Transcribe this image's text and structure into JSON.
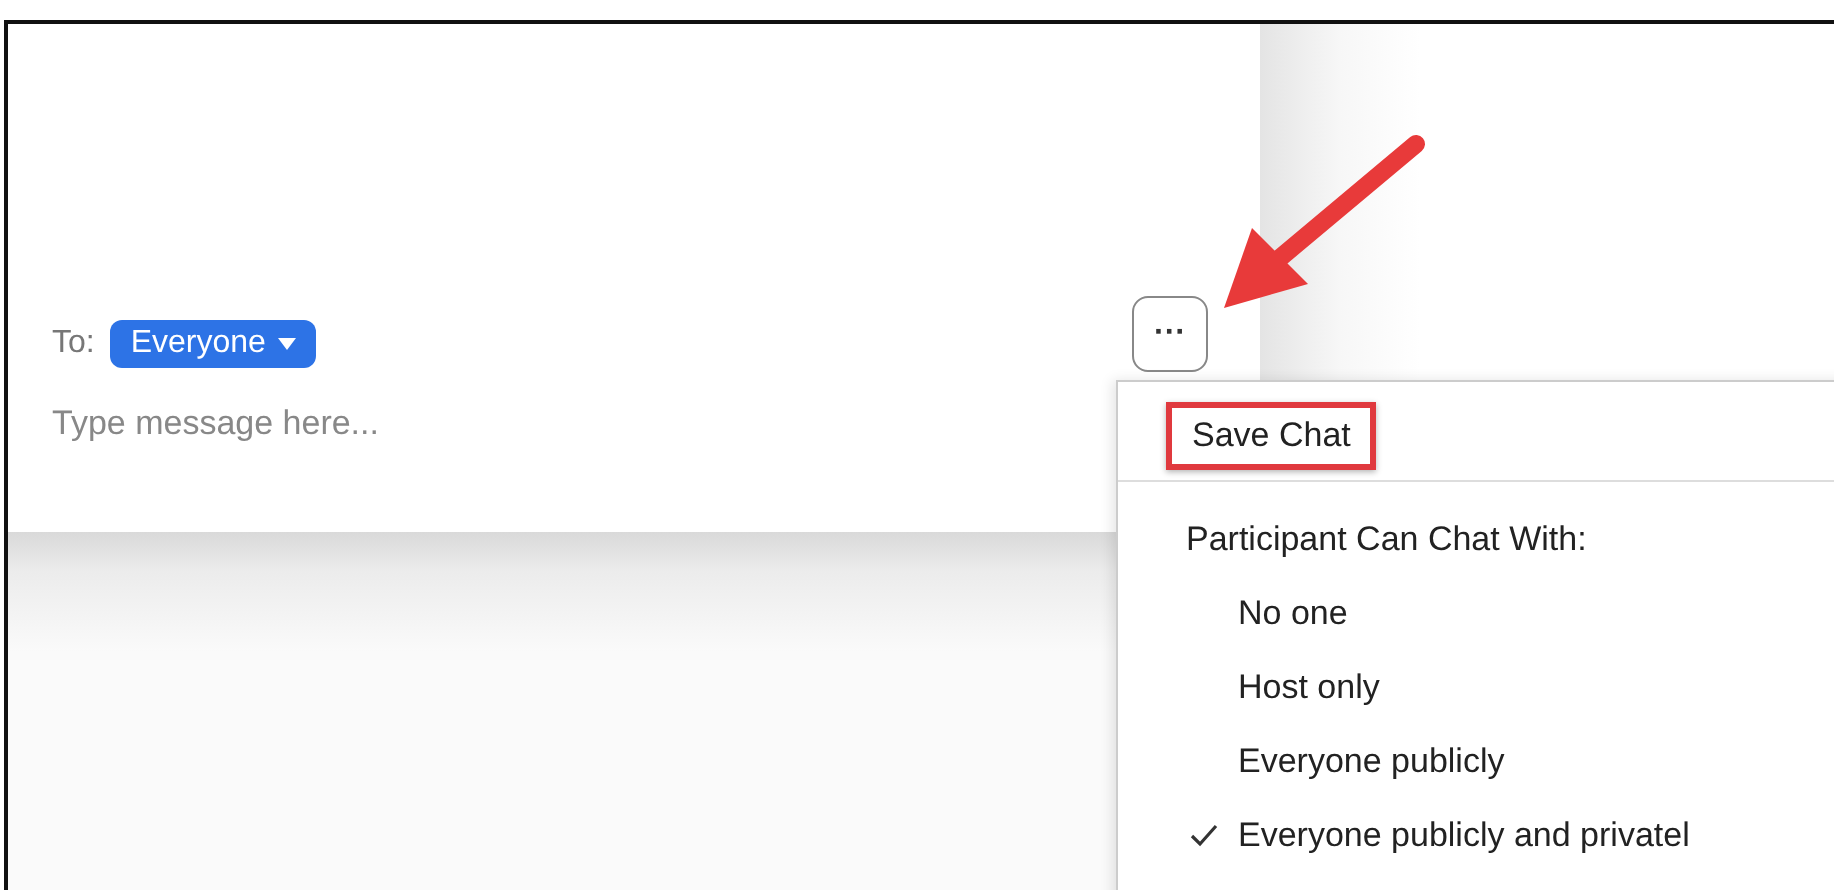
{
  "chat": {
    "to_label": "To:",
    "recipient": "Everyone",
    "placeholder": "Type message here...",
    "more_button": "···"
  },
  "menu": {
    "items": [
      {
        "kind": "action",
        "label": "Save Chat",
        "highlighted": true
      },
      {
        "kind": "divider"
      },
      {
        "kind": "header",
        "label": "Participant Can Chat With:"
      },
      {
        "kind": "option",
        "label": "No one",
        "checked": false
      },
      {
        "kind": "option",
        "label": "Host only",
        "checked": false
      },
      {
        "kind": "option",
        "label": "Everyone publicly",
        "checked": false
      },
      {
        "kind": "option",
        "label": "Everyone publicly and privatel",
        "checked": true
      }
    ]
  }
}
